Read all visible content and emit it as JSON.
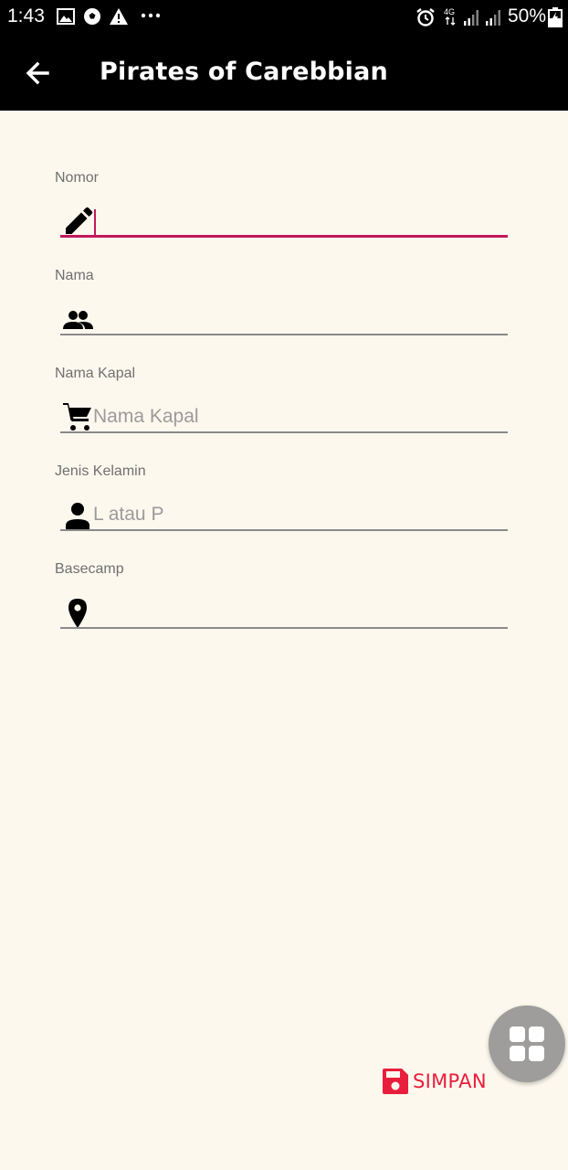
{
  "status_bar": {
    "time": "1:43",
    "network": "4G",
    "battery": "50%",
    "icons": [
      "image-icon",
      "soccer-ball-icon",
      "warning-icon",
      "more-dots-icon",
      "alarm-icon",
      "network-4g-icon",
      "signal-icon",
      "signal-icon",
      "battery-icon"
    ]
  },
  "app_bar": {
    "title": "Pirates of Carebbian",
    "back_icon": "arrow-back-icon"
  },
  "form": {
    "fields": [
      {
        "label": "Nomor",
        "value": "",
        "placeholder": "",
        "icon": "pencil-icon",
        "focused": true
      },
      {
        "label": "Nama",
        "value": "",
        "placeholder": "",
        "icon": "people-icon"
      },
      {
        "label": "Nama Kapal",
        "value": "",
        "placeholder": "Nama Kapal",
        "icon": "cart-icon"
      },
      {
        "label": "Jenis Kelamin",
        "value": "",
        "placeholder": "L atau P",
        "icon": "person-icon"
      },
      {
        "label": "Basecamp",
        "value": "",
        "placeholder": "",
        "icon": "location-pin-icon"
      }
    ]
  },
  "actions": {
    "save_label": "SIMPAN",
    "save_icon": "save-icon",
    "fab_icon": "grid-icon"
  },
  "colors": {
    "accent": "#c2185b",
    "save": "#e91e3c",
    "background": "#fdf8ee",
    "bar": "#000000",
    "fab": "#9e9d9b"
  }
}
